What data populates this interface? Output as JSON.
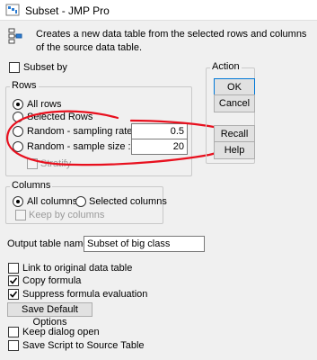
{
  "window": {
    "title": "Subset - JMP Pro"
  },
  "description": "Creates a new data table from the selected rows and columns of the source data table.",
  "subset_by": {
    "label": "Subset by",
    "checked": false
  },
  "rows": {
    "label": "Rows",
    "all_rows": "All rows",
    "selected_rows": "Selected Rows",
    "sampling_rate_label": "Random - sampling rate:",
    "sampling_rate_value": "0.5",
    "sample_size_label": "Random - sample size :",
    "sample_size_value": "20",
    "stratify": "Stratify",
    "selected": "all_rows"
  },
  "action": {
    "label": "Action",
    "ok": "OK",
    "cancel": "Cancel",
    "recall": "Recall",
    "help": "Help"
  },
  "columns": {
    "label": "Columns",
    "all_columns": "All columns",
    "selected_columns": "Selected columns",
    "keep_by_columns": "Keep by columns",
    "selected": "all_columns"
  },
  "output": {
    "label": "Output table name:",
    "value": "Subset of big class"
  },
  "options": {
    "link_original": {
      "label": "Link to original data table",
      "checked": false
    },
    "copy_formula": {
      "label": "Copy formula",
      "checked": true
    },
    "suppress_formula": {
      "label": "Suppress formula evaluation",
      "checked": true
    },
    "save_default": "Save Default Options",
    "keep_dialog_open": {
      "label": "Keep dialog open",
      "checked": false
    },
    "save_script": {
      "label": "Save Script to Source Table",
      "checked": false
    }
  },
  "colors": {
    "annotation": "#e8101e",
    "focus": "#0078d7"
  },
  "icons": {
    "app": "jmp-app-icon",
    "subset": "subset-table-icon"
  }
}
